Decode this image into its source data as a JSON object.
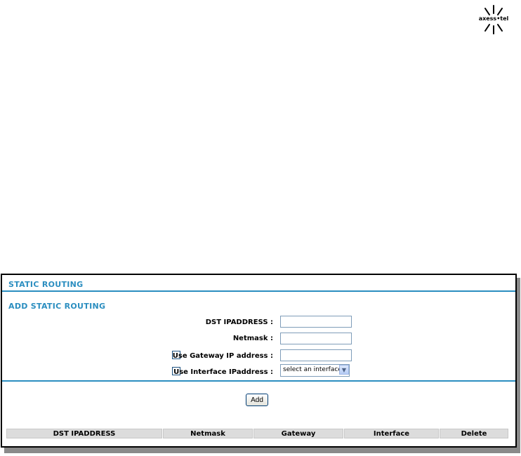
{
  "logo": {
    "text": "axess•tel"
  },
  "static_routing": {
    "title": "STATIC ROUTING",
    "add_section_title": "ADD STATIC ROUTING",
    "fields": {
      "dst_label": "DST IPADDRESS :",
      "dst_value": "",
      "netmask_label": "Netmask :",
      "netmask_value": "",
      "gateway_label": "Use Gateway IP address :",
      "gateway_checked": false,
      "gateway_value": "",
      "interface_label": "Use Interface IPaddress :",
      "interface_checked": false,
      "interface_selected": "select an interface"
    },
    "add_button": "Add",
    "table": {
      "columns": [
        "DST IPADDRESS",
        "Netmask",
        "Gateway",
        "Interface",
        "Delete"
      ],
      "rows": []
    }
  }
}
